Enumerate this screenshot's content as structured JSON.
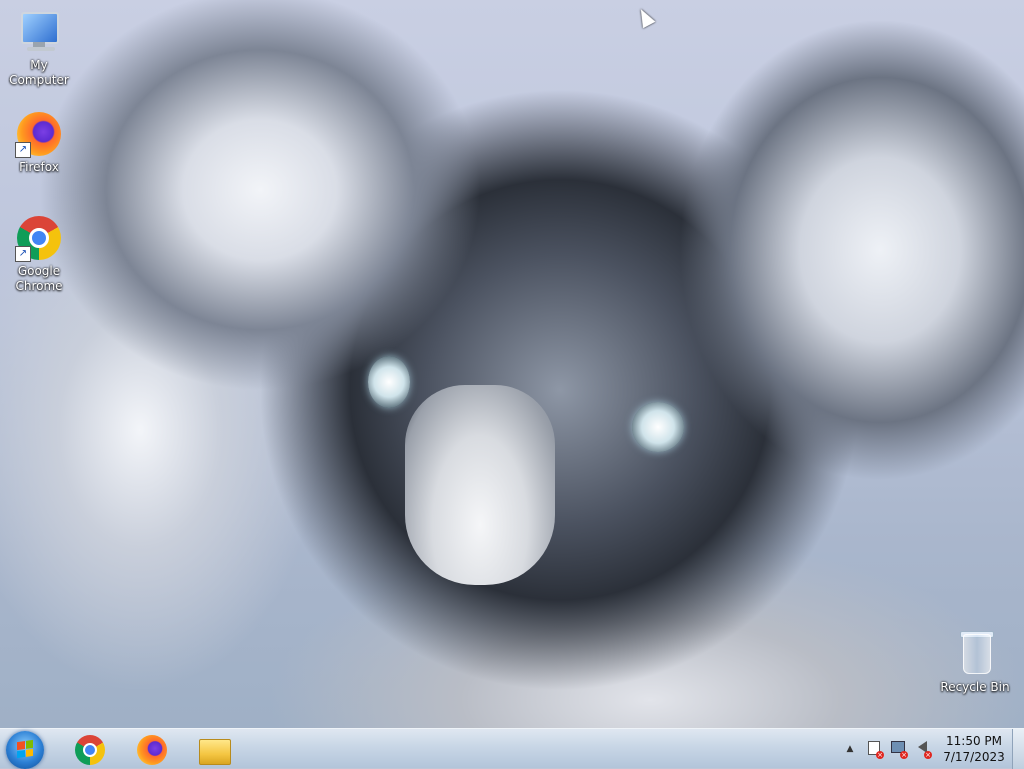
{
  "desktop": {
    "icons": [
      {
        "label": "My Computer",
        "icon": "computer-icon"
      },
      {
        "label": "Firefox",
        "icon": "firefox-icon"
      },
      {
        "label": "Google Chrome",
        "icon": "chrome-icon"
      },
      {
        "label": "Recycle Bin",
        "icon": "recycle-bin-icon"
      }
    ]
  },
  "taskbar": {
    "start_icon": "windows-start-icon",
    "pinned": [
      {
        "name": "Google Chrome",
        "icon": "chrome-icon"
      },
      {
        "name": "Firefox",
        "icon": "firefox-icon"
      },
      {
        "name": "Windows Explorer",
        "icon": "folder-icon"
      }
    ],
    "tray": {
      "show_hidden": "▲",
      "icons": [
        "action-center-icon",
        "network-icon",
        "volume-muted-icon"
      ]
    },
    "clock": {
      "time": "11:50 PM",
      "date": "7/17/2023"
    }
  },
  "colors": {
    "taskbar_top": "#dfe7f1",
    "taskbar_bottom": "#b3c5da",
    "accent_blue": "#2c7fd4",
    "status_red": "#e0261f"
  }
}
